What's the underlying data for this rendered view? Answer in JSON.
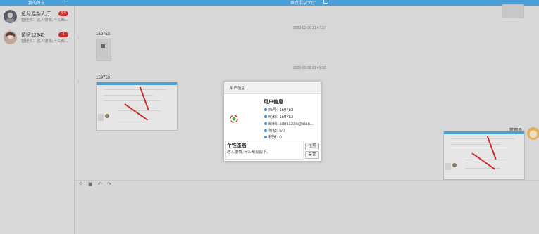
{
  "topbar": {
    "left_label": "我的好友",
    "add_symbol": "+",
    "title": "鱼龙混杂大厅"
  },
  "sidebar": {
    "contacts": [
      {
        "name": "鱼龙混杂大厅",
        "preview": "管理员：这人很懒,什么都...",
        "badge": "54"
      },
      {
        "name": "傻妞12345",
        "preview": "管理员：这人很懒,什么都...",
        "badge": "6"
      }
    ]
  },
  "chat": {
    "messages": [
      {
        "timestamp": "2020-01-30 21:47:37",
        "sender": "159753",
        "quote": "'"
      },
      {
        "timestamp": "2020-01-30 21:49:02",
        "sender": "159753",
        "quote": "'"
      }
    ],
    "self_sender": "管理员"
  },
  "toolbar": {
    "emoji": "☺",
    "image": "▣",
    "undo": "↶",
    "redo": "↷"
  },
  "modal": {
    "title": "用户信息",
    "info_title": "用户信息",
    "fields": [
      "账号: 159753",
      "昵称: 159753",
      "邮箱: admi123n@xian...",
      "等级: lv0",
      "积分: 0"
    ],
    "signature_title": "个性签名",
    "signature_text": "这人很懒,什么都没留下。",
    "buttons": [
      "拉黑",
      "禁言"
    ]
  },
  "colors": {
    "topbar": "#4a9fd8",
    "badge": "#c9302c",
    "info_dot": "#3a8ad0"
  }
}
